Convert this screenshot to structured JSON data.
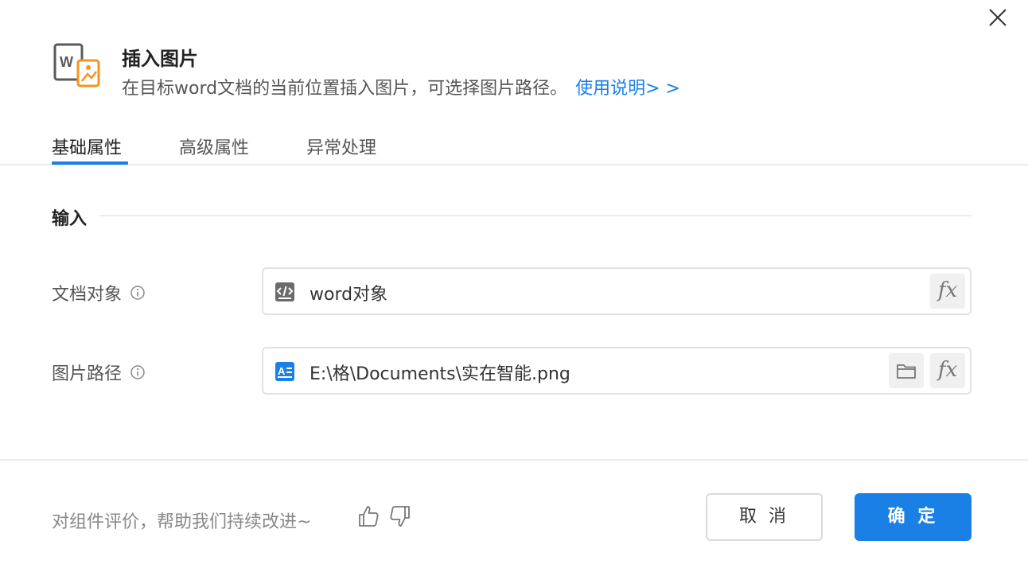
{
  "dialog": {
    "title": "插入图片",
    "description": "在目标word文档的当前位置插入图片，可选择图片路径。",
    "help_link": "使用说明> >"
  },
  "tabs": [
    {
      "label": "基础属性",
      "active": true
    },
    {
      "label": "高级属性",
      "active": false
    },
    {
      "label": "异常处理",
      "active": false
    }
  ],
  "section": {
    "title": "输入"
  },
  "fields": {
    "doc_object": {
      "label": "文档对象",
      "value": "word对象",
      "icon": "code-variable-icon"
    },
    "image_path": {
      "label": "图片路径",
      "value": "E:\\格\\Documents\\实在智能.png",
      "icon": "text-string-icon"
    }
  },
  "fx_label": "fx",
  "footer": {
    "feedback": "对组件评价，帮助我们持续改进~",
    "cancel": "取 消",
    "ok": "确 定"
  },
  "colors": {
    "accent": "#1a80e6",
    "icon_orange": "#f7931e",
    "icon_gray": "#5a5a5a"
  }
}
